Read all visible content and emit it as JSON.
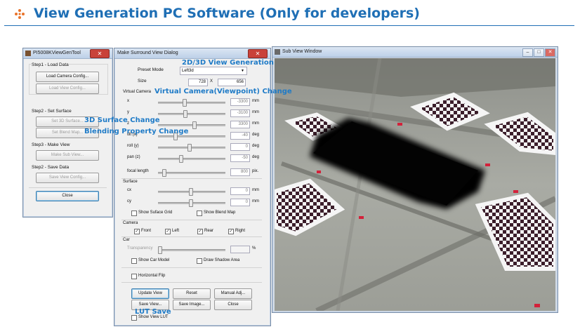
{
  "slide": {
    "title": "View Generation PC Software (Only for developers)"
  },
  "tool_window": {
    "title": "PI5008KViewGenTool",
    "step1_label": "Step1 - Load Data",
    "load_camera_btn": "Load Camera Config...",
    "load_view_btn": "Load View Config...",
    "step2_label": "Step2 - Set Surface",
    "set_3d_surface_btn": "Set 3D Surface...",
    "set_blend_map_btn": "Set Blend Map...",
    "step3_label": "Step3 - Make View",
    "make_sub_view_btn": "Make Sub View...",
    "step2_save_label": "Step2 - Save Data",
    "save_view_btn": "Save View Config...",
    "close_btn": "Close"
  },
  "dialog": {
    "title": "Make Surround View Dialog",
    "preset_mode_label": "Preset Mode",
    "preset_mode_value": "Left3d",
    "size_label": "Size",
    "size_w": "728",
    "size_x": "X",
    "size_h": "656",
    "virtual_camera_label": "Virtual Camera",
    "vc_rows": [
      {
        "label": "x",
        "value": "-3300",
        "unit": "mm",
        "pos": 0.38
      },
      {
        "label": "y",
        "value": "-3100",
        "unit": "mm",
        "pos": 0.39
      },
      {
        "label": "z",
        "value": "3300",
        "unit": "mm",
        "pos": 0.53
      },
      {
        "label": "tilt (x)",
        "value": "-40",
        "unit": "deg",
        "pos": 0.24
      },
      {
        "label": "roll (y)",
        "value": "0",
        "unit": "deg",
        "pos": 0.46
      },
      {
        "label": "pan (z)",
        "value": "-50",
        "unit": "deg",
        "pos": 0.33
      }
    ],
    "focal_length_label": "focal length",
    "focal_length_value": "800",
    "focal_length_unit": "pix.",
    "surface_label": "Surface",
    "surface_rows": [
      {
        "label": "cx",
        "value": "0",
        "unit": "mm"
      },
      {
        "label": "cy",
        "value": "0",
        "unit": "mm"
      }
    ],
    "show_surface_grid": "Show Suface Grid",
    "show_blend_map": "Show Blend Map",
    "camera_label": "Camera",
    "cameras": [
      {
        "label": "Front",
        "checked": true
      },
      {
        "label": "Left",
        "checked": true
      },
      {
        "label": "Rear",
        "checked": true
      },
      {
        "label": "Right",
        "checked": true
      }
    ],
    "car_label": "Car",
    "transparency_label": "Transparency",
    "transparency_unit": "%",
    "show_car_model": "Show Car Model",
    "draw_shadow_area": "Draw Shadow Area",
    "horizontal_flip": "Horizontal Flip",
    "update_view_btn": "Update View",
    "reset_btn": "Reset",
    "manual_adj_btn": "Manual Adj...",
    "save_view_btn": "Save View...",
    "save_image_btn": "Save Image...",
    "close_btn": "Close",
    "show_view_lut": "Show View LUT"
  },
  "sub_view": {
    "title": "Sub View Window"
  },
  "annotations": {
    "view_generation": "2D/3D View Generation",
    "virtual_camera": "Virtual Camera(Viewpoint) Change",
    "surface_change": "3D Surface Change",
    "blending_change": "Blending Property Change",
    "lut_save": "LUT Save"
  },
  "colors": {
    "title_blue": "#1f6fb5",
    "annotation_blue": "#1f7bc7",
    "close_red": "#c9423a"
  }
}
